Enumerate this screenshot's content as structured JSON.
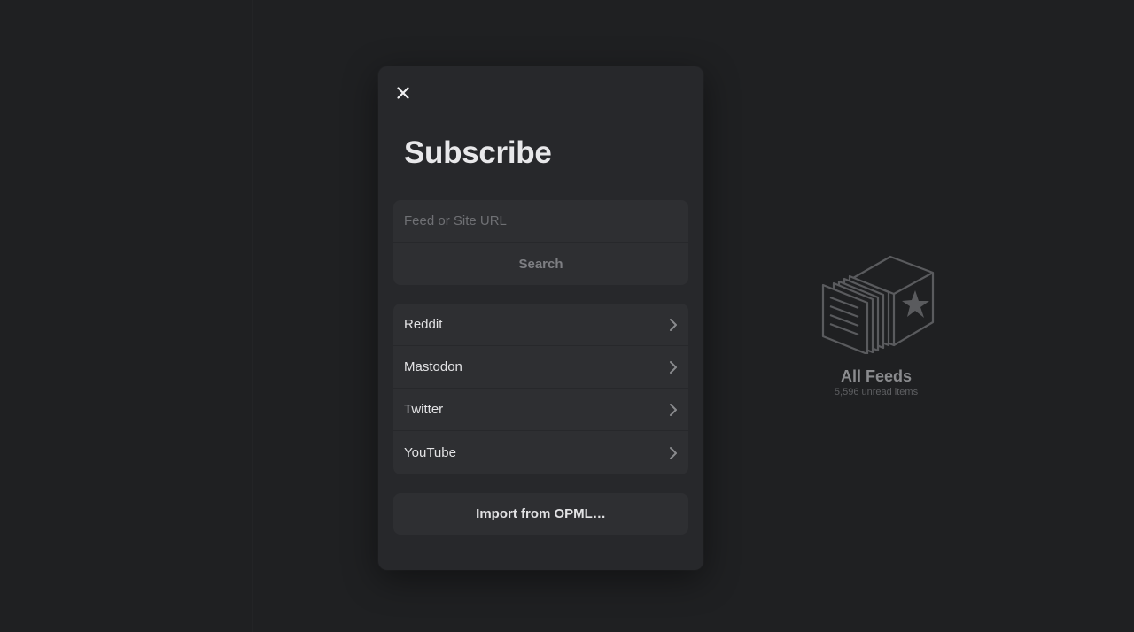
{
  "sidebar": {},
  "empty_state": {
    "icon": "feeds-box-star-icon",
    "title": "All Feeds",
    "subtitle": "5,596 unread items"
  },
  "modal": {
    "close_icon": "close-icon",
    "title": "Subscribe",
    "url_input": {
      "value": "",
      "placeholder": "Feed or Site URL"
    },
    "search_label": "Search",
    "services": [
      {
        "label": "Reddit",
        "icon": "chevron-right-icon"
      },
      {
        "label": "Mastodon",
        "icon": "chevron-right-icon"
      },
      {
        "label": "Twitter",
        "icon": "chevron-right-icon"
      },
      {
        "label": "YouTube",
        "icon": "chevron-right-icon"
      }
    ],
    "import_label": "Import from OPML…"
  },
  "colors": {
    "background": "#1f2022",
    "modal": "#27282b",
    "group": "#2e2f32",
    "text": "#e2e2e4",
    "muted": "#7e7f83"
  }
}
